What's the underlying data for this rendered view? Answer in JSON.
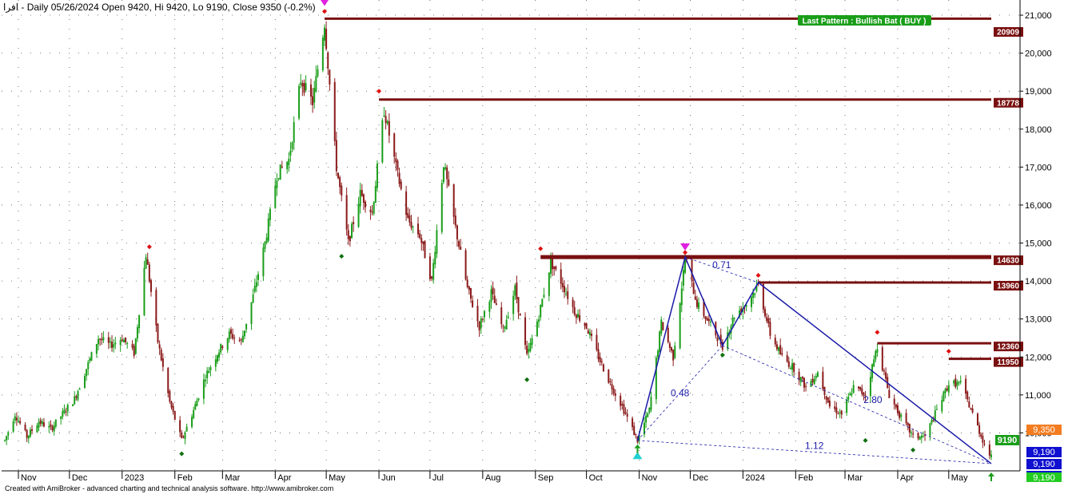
{
  "chart_data": {
    "type": "candlestick",
    "title": "افرا - Daily 05/26/2024 Open 9420, Hi 9420, Lo 9190, Close 9350 (-0.2%)",
    "footer": "Created with AmiBroker - advanced charting and technical analysis software. http://www.amibroker.com",
    "pattern_label": "Last Pattern : Bullish Bat ( BUY )",
    "ylim": [
      9000,
      21400
    ],
    "y_ticks": [
      "10,000",
      "11,000",
      "12,000",
      "13,000",
      "14,000",
      "15,000",
      "16,000",
      "17,000",
      "18,000",
      "19,000",
      "20,000",
      "21,000"
    ],
    "y_tick_values": [
      10000,
      11000,
      12000,
      13000,
      14000,
      15000,
      16000,
      17000,
      18000,
      19000,
      20000,
      21000
    ],
    "x_ticks": [
      "Nov",
      "Dec",
      "2023",
      "Feb",
      "Mar",
      "Apr",
      "May",
      "Jun",
      "Jul",
      "Aug",
      "Sep",
      "Oct",
      "Nov",
      "Dec",
      "2024",
      "Feb",
      "Mar",
      "Apr",
      "May"
    ],
    "resistance_levels": [
      {
        "label": "20909",
        "value": 20909
      },
      {
        "label": "18778",
        "value": 18778
      },
      {
        "label": "14630",
        "value": 14630
      },
      {
        "label": "13960",
        "value": 13960
      },
      {
        "label": "12360",
        "value": 12360
      },
      {
        "label": "11950",
        "value": 11950
      }
    ],
    "right_tags": [
      {
        "label": "9,350",
        "value": 9350,
        "color": "#f47c20"
      },
      {
        "label": "9190",
        "value": 9190,
        "color": "#1a9e1a"
      },
      {
        "label": "9,190",
        "value": 9190,
        "color": "#1010d0"
      },
      {
        "label": "9,190",
        "value": 9190,
        "color": "#1010d0"
      },
      {
        "label": "9,190",
        "value": 9190,
        "color": "#1010d0"
      },
      {
        "label": "9,190",
        "value": 9190,
        "color": "#22cc22"
      }
    ],
    "pattern_ratios": [
      "0.71",
      "0.48",
      "2.80",
      "1.12"
    ],
    "harmonic_points": {
      "X": {
        "date": "2023-10-31",
        "value": 9800
      },
      "A": {
        "date": "2023-11-28",
        "value": 14630
      },
      "B": {
        "date": "2023-12-20",
        "value": 12300
      },
      "C": {
        "date": "2024-01-10",
        "value": 13960
      },
      "D": {
        "date": "2024-05-26",
        "value": 9190
      }
    },
    "price_path": [
      {
        "date": "2022-10-24",
        "value": 9800
      },
      {
        "date": "2022-10-30",
        "value": 10500
      },
      {
        "date": "2022-11-06",
        "value": 9900
      },
      {
        "date": "2022-11-13",
        "value": 10300
      },
      {
        "date": "2022-11-20",
        "value": 10100
      },
      {
        "date": "2022-11-27",
        "value": 10500
      },
      {
        "date": "2022-12-04",
        "value": 10900
      },
      {
        "date": "2022-12-11",
        "value": 11700
      },
      {
        "date": "2022-12-18",
        "value": 12500
      },
      {
        "date": "2022-12-25",
        "value": 12300
      },
      {
        "date": "2023-01-01",
        "value": 12500
      },
      {
        "date": "2023-01-08",
        "value": 12100
      },
      {
        "date": "2023-01-15",
        "value": 14700
      },
      {
        "date": "2023-01-22",
        "value": 12400
      },
      {
        "date": "2023-01-29",
        "value": 10800
      },
      {
        "date": "2023-02-05",
        "value": 9800
      },
      {
        "date": "2023-02-12",
        "value": 10600
      },
      {
        "date": "2023-02-19",
        "value": 11500
      },
      {
        "date": "2023-02-26",
        "value": 12100
      },
      {
        "date": "2023-03-05",
        "value": 12600
      },
      {
        "date": "2023-03-12",
        "value": 12400
      },
      {
        "date": "2023-03-19",
        "value": 13600
      },
      {
        "date": "2023-03-26",
        "value": 15000
      },
      {
        "date": "2023-04-02",
        "value": 16800
      },
      {
        "date": "2023-04-09",
        "value": 17200
      },
      {
        "date": "2023-04-16",
        "value": 19300
      },
      {
        "date": "2023-04-23",
        "value": 18700
      },
      {
        "date": "2023-04-30",
        "value": 20800
      },
      {
        "date": "2023-05-07",
        "value": 17000
      },
      {
        "date": "2023-05-14",
        "value": 15000
      },
      {
        "date": "2023-05-21",
        "value": 16300
      },
      {
        "date": "2023-05-28",
        "value": 15800
      },
      {
        "date": "2023-06-04",
        "value": 18500
      },
      {
        "date": "2023-06-11",
        "value": 17000
      },
      {
        "date": "2023-06-18",
        "value": 15600
      },
      {
        "date": "2023-06-25",
        "value": 15200
      },
      {
        "date": "2023-07-02",
        "value": 14000
      },
      {
        "date": "2023-07-09",
        "value": 17100
      },
      {
        "date": "2023-07-16",
        "value": 15400
      },
      {
        "date": "2023-07-23",
        "value": 13800
      },
      {
        "date": "2023-07-30",
        "value": 12800
      },
      {
        "date": "2023-08-06",
        "value": 13700
      },
      {
        "date": "2023-08-13",
        "value": 12700
      },
      {
        "date": "2023-08-20",
        "value": 13800
      },
      {
        "date": "2023-08-27",
        "value": 12000
      },
      {
        "date": "2023-09-03",
        "value": 13100
      },
      {
        "date": "2023-09-10",
        "value": 14500
      },
      {
        "date": "2023-09-17",
        "value": 13900
      },
      {
        "date": "2023-09-24",
        "value": 13200
      },
      {
        "date": "2023-10-01",
        "value": 12800
      },
      {
        "date": "2023-10-08",
        "value": 12000
      },
      {
        "date": "2023-10-15",
        "value": 11300
      },
      {
        "date": "2023-10-22",
        "value": 10700
      },
      {
        "date": "2023-10-31",
        "value": 9800
      },
      {
        "date": "2023-11-07",
        "value": 10600
      },
      {
        "date": "2023-11-14",
        "value": 12900
      },
      {
        "date": "2023-11-21",
        "value": 12000
      },
      {
        "date": "2023-11-28",
        "value": 14600
      },
      {
        "date": "2023-12-05",
        "value": 13400
      },
      {
        "date": "2023-12-12",
        "value": 12900
      },
      {
        "date": "2023-12-20",
        "value": 12300
      },
      {
        "date": "2023-12-27",
        "value": 13100
      },
      {
        "date": "2024-01-03",
        "value": 13400
      },
      {
        "date": "2024-01-10",
        "value": 13900
      },
      {
        "date": "2024-01-17",
        "value": 12600
      },
      {
        "date": "2024-01-24",
        "value": 12000
      },
      {
        "date": "2024-01-31",
        "value": 11700
      },
      {
        "date": "2024-02-07",
        "value": 11200
      },
      {
        "date": "2024-02-14",
        "value": 11600
      },
      {
        "date": "2024-02-21",
        "value": 10700
      },
      {
        "date": "2024-02-28",
        "value": 10500
      },
      {
        "date": "2024-03-06",
        "value": 11200
      },
      {
        "date": "2024-03-13",
        "value": 11000
      },
      {
        "date": "2024-03-20",
        "value": 12300
      },
      {
        "date": "2024-03-27",
        "value": 11000
      },
      {
        "date": "2024-04-03",
        "value": 10400
      },
      {
        "date": "2024-04-10",
        "value": 9900
      },
      {
        "date": "2024-04-17",
        "value": 9900
      },
      {
        "date": "2024-04-24",
        "value": 10600
      },
      {
        "date": "2024-05-01",
        "value": 11300
      },
      {
        "date": "2024-05-08",
        "value": 11300
      },
      {
        "date": "2024-05-15",
        "value": 10500
      },
      {
        "date": "2024-05-22",
        "value": 9700
      },
      {
        "date": "2024-05-26",
        "value": 9350
      }
    ],
    "swing_highs": [
      {
        "date": "2023-01-17",
        "value": 14900
      },
      {
        "date": "2023-04-30",
        "value": 21100
      },
      {
        "date": "2023-06-01",
        "value": 19000
      },
      {
        "date": "2023-09-04",
        "value": 14850
      },
      {
        "date": "2023-11-28",
        "value": 14750
      },
      {
        "date": "2024-01-10",
        "value": 14150
      },
      {
        "date": "2024-03-20",
        "value": 12650
      },
      {
        "date": "2024-05-01",
        "value": 12150
      }
    ],
    "swing_lows": [
      {
        "date": "2023-02-05",
        "value": 9450
      },
      {
        "date": "2023-05-10",
        "value": 14650
      },
      {
        "date": "2023-08-27",
        "value": 11400
      },
      {
        "date": "2023-12-20",
        "value": 12050
      },
      {
        "date": "2024-03-13",
        "value": 9800
      },
      {
        "date": "2024-04-10",
        "value": 9550
      }
    ],
    "colors": {
      "up": "#1a9e1a",
      "down": "#8b1a1a",
      "level": "#7a1010",
      "pattern": "#1a1aa8",
      "marker_pink": "#e020e0",
      "marker_cyan": "#20d0d0",
      "diamond_red": "#e01010",
      "diamond_green": "#107010",
      "pattern_badge": "#1a9e1a"
    }
  }
}
